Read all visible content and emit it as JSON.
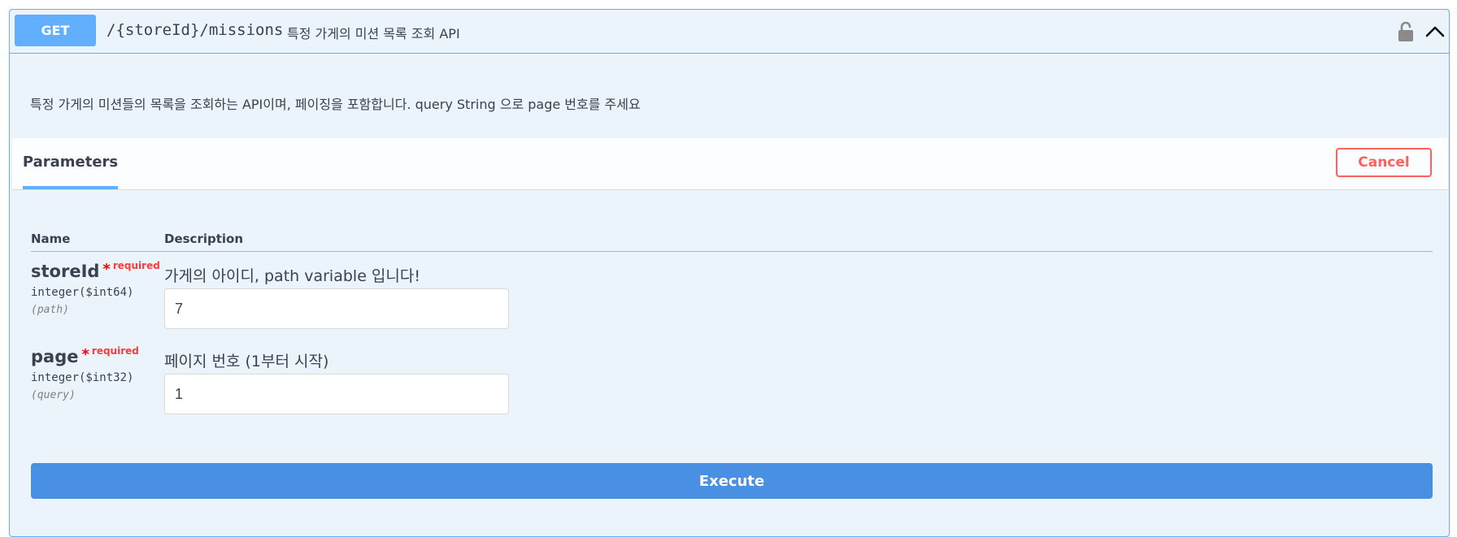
{
  "operation": {
    "method": "GET",
    "path": "/{storeId}/missions",
    "summary": "특정 가게의 미션 목록 조회 API",
    "description": "특정 가게의 미션들의 목록을 조회하는 API이며, 페이징을 포함합니다. query String 으로 page 번호를 주세요",
    "lock_icon": "unlocked-lock-icon",
    "collapse_icon": "chevron-up-icon"
  },
  "parameters_tab": {
    "label": "Parameters",
    "cancel_label": "Cancel"
  },
  "table": {
    "name_header": "Name",
    "description_header": "Description"
  },
  "params": [
    {
      "name": "storeId",
      "required_star": "*",
      "required_label": "required",
      "type": "integer($int64)",
      "in": "(path)",
      "description": "가게의 아이디, path variable 입니다!",
      "value": "7"
    },
    {
      "name": "page",
      "required_star": "*",
      "required_label": "required",
      "type": "integer($int32)",
      "in": "(query)",
      "description": "페이지 번호 (1부터 시작)",
      "value": "1"
    }
  ],
  "execute_label": "Execute",
  "colors": {
    "get_method": "#61affe",
    "block_background": "#ebf3fb",
    "cancel": "#ff6060",
    "execute": "#4990e2",
    "required": "#ff3939"
  }
}
